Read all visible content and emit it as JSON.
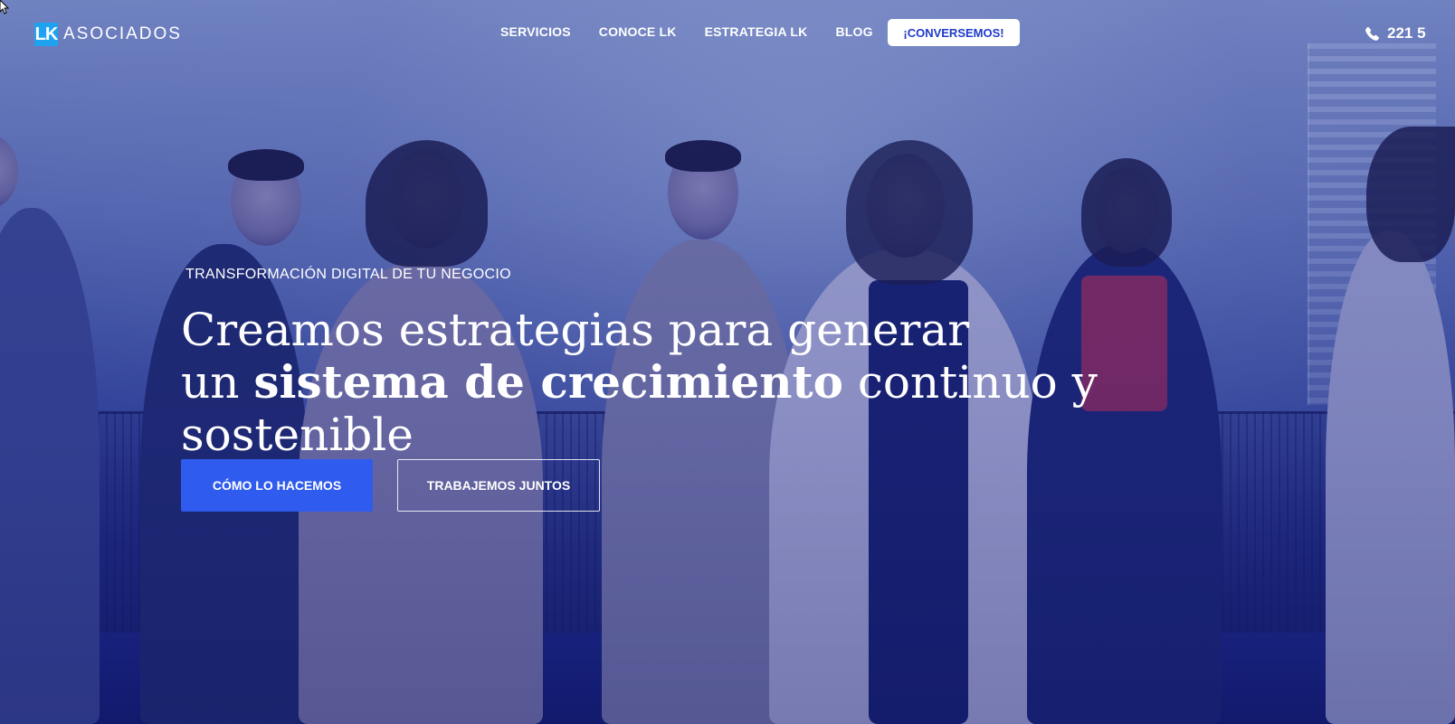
{
  "brand": {
    "mark": "LK",
    "name": "ASOCIADOS"
  },
  "nav": {
    "links": [
      "SERVICIOS",
      "CONOCE LK",
      "ESTRATEGIA LK",
      "BLOG"
    ],
    "cta": "¡CONVERSEMOS!",
    "phone": "221 5"
  },
  "hero": {
    "eyebrow": "TRANSFORMACIÓN DIGITAL DE TU NEGOCIO",
    "headline": {
      "line1": "Creamos estrategias para generar",
      "line2_prefix": "un ",
      "line2_bold": "sistema de crecimiento",
      "line2_suffix": " continuo y sostenible"
    },
    "buttons": {
      "primary": "CÓMO LO HACEMOS",
      "secondary": "TRABAJEMOS JUNTOS"
    }
  },
  "colors": {
    "accent": "#2f5bef",
    "logo_blue": "#1fa3f0",
    "overlay": "#23308a",
    "cta_text": "#1f3bcb"
  },
  "icons": [
    "phone-icon",
    "mouse-cursor-icon"
  ]
}
